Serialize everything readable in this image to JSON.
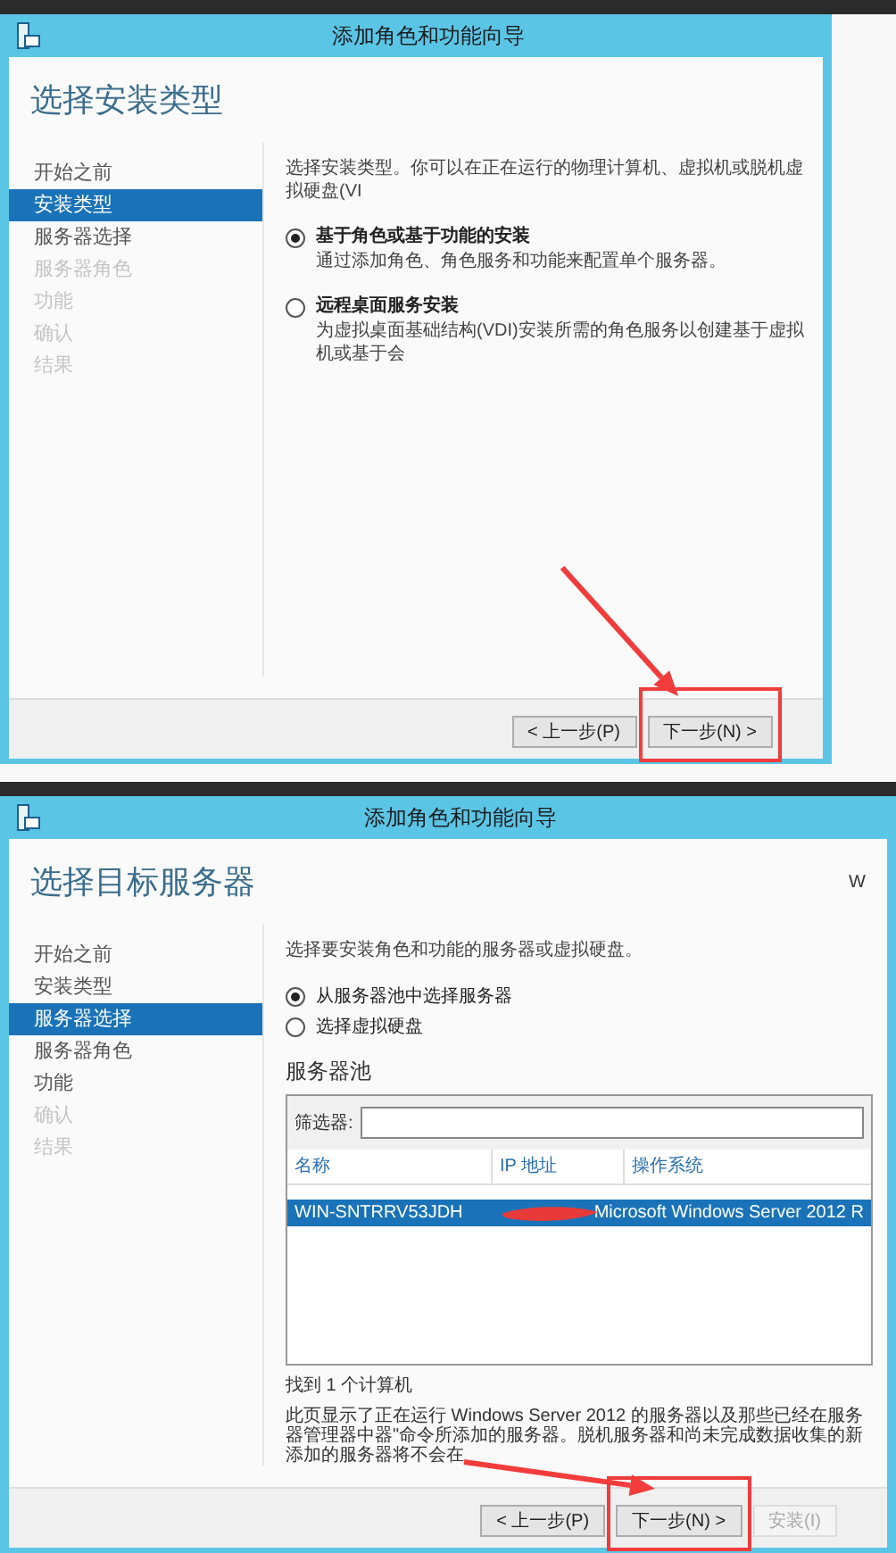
{
  "panels": [
    {
      "title": "添加角色和功能向导",
      "heading": "选择安装类型",
      "steps": [
        {
          "label": "开始之前",
          "selected": false,
          "disabled": false
        },
        {
          "label": "安装类型",
          "selected": true,
          "disabled": false
        },
        {
          "label": "服务器选择",
          "selected": false,
          "disabled": false
        },
        {
          "label": "服务器角色",
          "selected": false,
          "disabled": true
        },
        {
          "label": "功能",
          "selected": false,
          "disabled": true
        },
        {
          "label": "确认",
          "selected": false,
          "disabled": true
        },
        {
          "label": "结果",
          "selected": false,
          "disabled": true
        }
      ],
      "content": {
        "kind": "install_type",
        "description": "选择安装类型。你可以在正在运行的物理计算机、虚拟机或脱机虚拟硬盘(VI",
        "options": [
          {
            "label": "基于角色或基于功能的安装",
            "description": "通过添加角色、角色服务和功能来配置单个服务器。",
            "selected": true
          },
          {
            "label": "远程桌面服务安装",
            "description": "为虚拟桌面基础结构(VDI)安装所需的角色服务以创建基于虚拟机或基于会",
            "selected": false
          }
        ]
      },
      "buttons": [
        {
          "label": "< 上一步(P)",
          "disabled": false,
          "annotated": false
        },
        {
          "label": "下一步(N) >",
          "disabled": false,
          "annotated": true
        }
      ]
    },
    {
      "title": "添加角色和功能向导",
      "heading": "选择目标服务器",
      "corner_text": "W",
      "steps": [
        {
          "label": "开始之前",
          "selected": false,
          "disabled": false
        },
        {
          "label": "安装类型",
          "selected": false,
          "disabled": false
        },
        {
          "label": "服务器选择",
          "selected": true,
          "disabled": false
        },
        {
          "label": "服务器角色",
          "selected": false,
          "disabled": false
        },
        {
          "label": "功能",
          "selected": false,
          "disabled": false
        },
        {
          "label": "确认",
          "selected": false,
          "disabled": true
        },
        {
          "label": "结果",
          "selected": false,
          "disabled": true
        }
      ],
      "content": {
        "kind": "server_select",
        "description": "选择要安装角色和功能的服务器或虚拟硬盘。",
        "options": [
          {
            "label": "从服务器池中选择服务器",
            "selected": true
          },
          {
            "label": "选择虚拟硬盘",
            "selected": false
          }
        ],
        "pool_label": "服务器池",
        "filter_label": "筛选器:",
        "columns": [
          "名称",
          "IP 地址",
          "操作系统"
        ],
        "rows": [
          {
            "name": "WIN-SNTRRV53JDH",
            "os": "Microsoft Windows Server 2012 R",
            "selected": true
          }
        ],
        "found": "找到 1 个计算机",
        "note": "此页显示了正在运行 Windows Server 2012 的服务器以及那些已经在服务器管理器中器\"命令所添加的服务器。脱机服务器和尚未完成数据收集的新添加的服务器将不会在"
      },
      "buttons": [
        {
          "label": "< 上一步(P)",
          "disabled": false,
          "annotated": false
        },
        {
          "label": "下一步(N) >",
          "disabled": false,
          "annotated": true
        },
        {
          "label": "安装(I)",
          "disabled": true,
          "annotated": false
        }
      ]
    }
  ]
}
